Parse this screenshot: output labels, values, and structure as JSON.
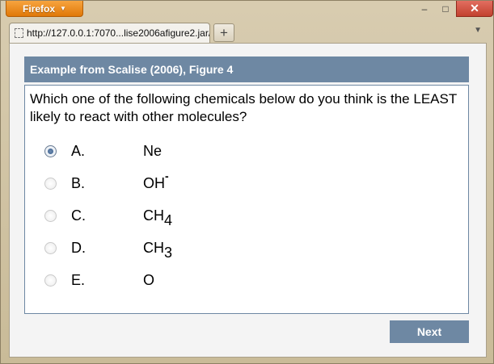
{
  "browser": {
    "menu_button_label": "Firefox",
    "menu_caret": "▼",
    "minimize_glyph": "–",
    "maximize_glyph": "□",
    "close_glyph": "✕",
    "tab_title": "http://127.0.0.1:7070...lise2006afigure2.jar/",
    "new_tab_glyph": "+",
    "tab_list_glyph": "▼"
  },
  "quiz": {
    "title": "Example from Scalise (2006), Figure 4",
    "question": "Which one of the following chemicals below do you think is the LEAST likely to react with other molecules?",
    "options": [
      {
        "letter": "A.",
        "formula": "Ne",
        "sub": "",
        "sup": "",
        "selected": true
      },
      {
        "letter": "B.",
        "formula": "OH",
        "sub": "",
        "sup": "-",
        "selected": false
      },
      {
        "letter": "C.",
        "formula": "CH",
        "sub": "4",
        "sup": "",
        "selected": false
      },
      {
        "letter": "D.",
        "formula": "CH",
        "sub": "3",
        "sup": "",
        "selected": false
      },
      {
        "letter": "E.",
        "formula": "O",
        "sub": "",
        "sup": "",
        "selected": false
      }
    ],
    "next_label": "Next"
  },
  "colors": {
    "accent": "#6e88a3",
    "firefox_orange": "#e07808",
    "close_red": "#c2412f"
  }
}
